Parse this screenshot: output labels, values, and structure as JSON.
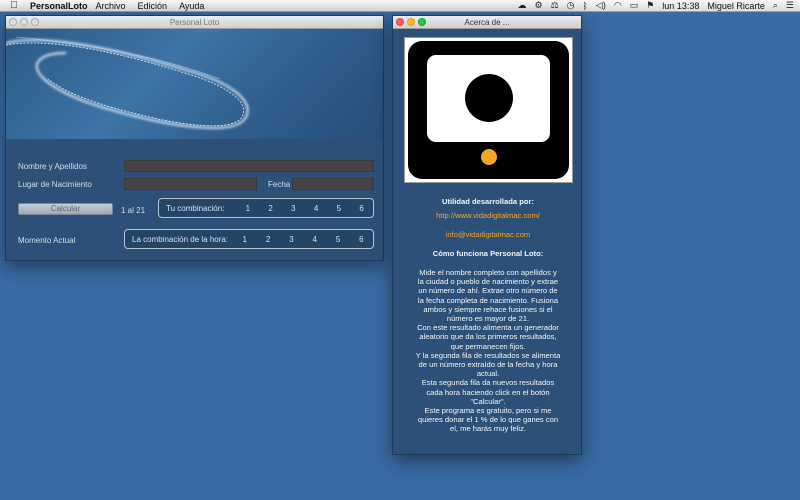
{
  "menubar": {
    "app_name": "PersonalLoto",
    "menus": [
      "Archivo",
      "Edición",
      "Ayuda"
    ],
    "clock": "lun 13:38",
    "user": "Miguel Ricarte"
  },
  "main_window": {
    "title": "Personal Loto",
    "labels": {
      "name": "Nombre y Apellidos",
      "birthplace": "Lugar de Nacimiento",
      "date": "Fecha",
      "current_moment": "Momento Actual"
    },
    "calculate_button": "Calcular",
    "range": "1 al 21",
    "combination_label": "Tu combinación:",
    "hour_combination_label": "La combinación de la hora:",
    "numbers": [
      "1",
      "2",
      "3",
      "4",
      "5",
      "6"
    ]
  },
  "about_window": {
    "title": "Acerca de ...",
    "developed_by": "Utilidad desarrollada por:",
    "website": "http://www.vidadigitalmac.com/",
    "email": "info@vidadigitalmac.com",
    "how_title": "Cómo funciona Personal Loto:",
    "description": [
      "Mide el nombre completo con apellidos y",
      "la ciudad o pueblo de nacimiento y extrae",
      "un número de ahí. Extrae otro número de",
      "la fecha completa de nacimiento. Fusiona",
      "ambos y siempre rehace fusiones si el",
      "número es mayor de 21.",
      "Con este resultado alimenta un generador",
      "aleatorio que da los primeros resultados,",
      "que permanecen fijos.",
      "Y la segunda fila de resultados se alimenta",
      "de un número extraído de la fecha y hora",
      "actual.",
      "Esta segunda fila da nuevos resultados",
      "cada hora haciendo click en el botón",
      "\"Calcular\".",
      "Este programa es gratuito, pero si me",
      "quieres donar el 1 % de lo que ganes con",
      "el, me harás muy feliz."
    ]
  },
  "colors": {
    "desktop": "#3a6ba3",
    "window_bg": "#2d5079",
    "accent_orange": "#f5a623"
  }
}
